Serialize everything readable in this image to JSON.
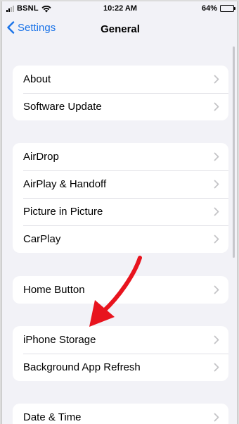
{
  "status_bar": {
    "carrier": "BSNL",
    "time": "10:22 AM",
    "battery_percent": "64%",
    "battery_level": 0.64
  },
  "nav": {
    "back_label": "Settings",
    "title": "General"
  },
  "groups": [
    {
      "items": [
        {
          "label": "About"
        },
        {
          "label": "Software Update"
        }
      ]
    },
    {
      "items": [
        {
          "label": "AirDrop"
        },
        {
          "label": "AirPlay & Handoff"
        },
        {
          "label": "Picture in Picture"
        },
        {
          "label": "CarPlay"
        }
      ]
    },
    {
      "items": [
        {
          "label": "Home Button"
        }
      ]
    },
    {
      "items": [
        {
          "label": "iPhone Storage"
        },
        {
          "label": "Background App Refresh"
        }
      ]
    },
    {
      "items": [
        {
          "label": "Date & Time"
        }
      ]
    }
  ],
  "colors": {
    "accent": "#1a73e8",
    "annotation_arrow": "#e8141e",
    "background": "#f2f2f7"
  },
  "icons": {
    "back": "chevron-left-icon",
    "disclosure": "chevron-right-icon",
    "wifi": "wifi-icon",
    "battery": "battery-icon",
    "annotation": "red-arrow-icon"
  }
}
